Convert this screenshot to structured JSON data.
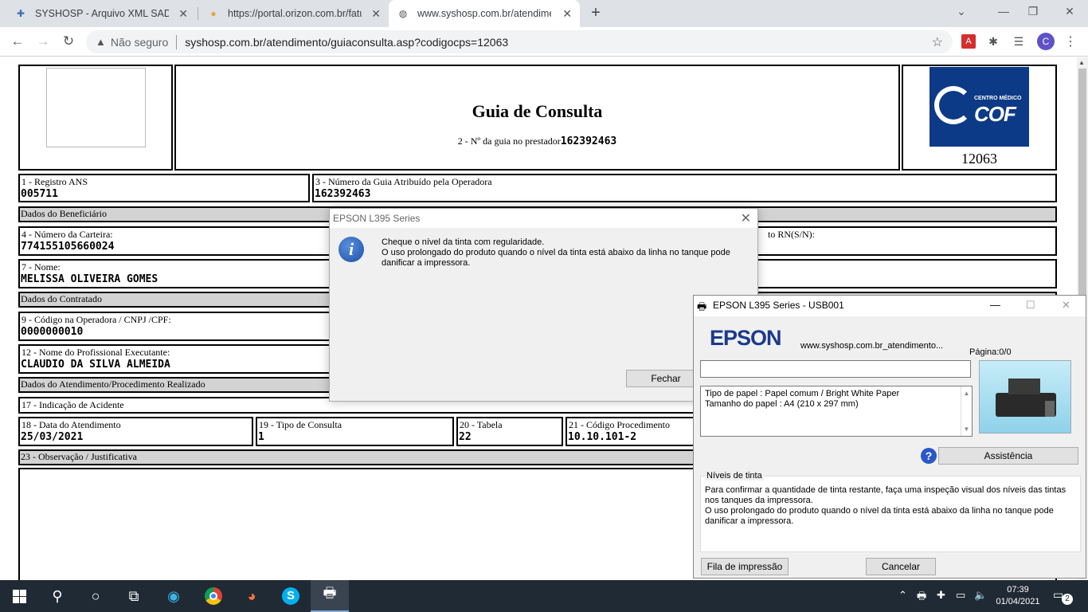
{
  "browser": {
    "tabs": [
      {
        "title": "SYSHOSP - Arquivo XML SADT",
        "icon": "syshosp-favicon"
      },
      {
        "title": "https://portal.orizon.com.br/fatur",
        "icon": "orizon-favicon"
      },
      {
        "title": "www.syshosp.com.br/atendiment",
        "icon": "globe-favicon"
      }
    ],
    "security_label": "Não seguro",
    "url": "syshosp.com.br/atendimento/guiaconsulta.asp?codigocps=12063",
    "profile_initial": "C"
  },
  "guia": {
    "title": "Guia de Consulta",
    "guia_prestador_label": "2 - Nº da guia no prestador",
    "guia_prestador_value": "162392463",
    "logo_line1": "CENTRO MÉDICO",
    "logo_line2": "COF",
    "codigo": "12063",
    "registro_ans_label": "1 - Registro ANS",
    "registro_ans_value": "005711",
    "numero_guia_operadora_label": "3 - Número da Guia Atribuído pela Operadora",
    "numero_guia_operadora_value": "162392463",
    "section_beneficiario": "Dados do Beneficiário",
    "carteira_label": "4 - Número da Carteira:",
    "carteira_value": "774155105660024",
    "rn_label": "to RN(S/N):",
    "nome_label": "7 - Nome:",
    "nome_value": "MELISSA OLIVEIRA GOMES",
    "section_contratado": "Dados do Contratado",
    "codigo_operadora_label": "9 - Código na Operadora / CNPJ /CPF:",
    "codigo_operadora_value": "0000000010",
    "profissional_label": "12 - Nome do Profissional Executante:",
    "profissional_value": "CLAUDIO DA SILVA ALMEIDA",
    "section_atendimento": "Dados do Atendimento/Procedimento Realizado",
    "acidente_label": "17 - Indicação de Acidente",
    "data_atendimento_label": "18 - Data do Atendimento",
    "data_atendimento_value": "25/03/2021",
    "tipo_consulta_label": "19 - Tipo de Consulta",
    "tipo_consulta_value": "1",
    "tabela_label": "20 - Tabela",
    "tabela_value": "22",
    "codigo_procedimento_label": "21 - Código Procedimento",
    "codigo_procedimento_value": "10.10.101-2",
    "observacao_label": "23 - Observação / Justificativa"
  },
  "epson_message": {
    "title": "EPSON L395 Series",
    "line1": "Cheque o nível da tinta com regularidade.",
    "line2": "O uso prolongado do produto quando o nível da tinta está abaixo da linha no tanque pode",
    "line3": "danificar a impressora.",
    "button": "Fechar"
  },
  "epson_window": {
    "title": "EPSON L395 Series - USB001",
    "logo": "EPSON",
    "document": "www.syshosp.com.br_atendimento...",
    "page_label": "Página:0/0",
    "paper_type": "Tipo de papel : Papel comum / Bright White Paper",
    "paper_size": "Tamanho do papel : A4 (210 x 297 mm)",
    "assist_button": "Assistência",
    "ink_group_label": "Níveis de tinta",
    "ink_line1": "Para confirmar a quantidade de tinta restante, faça uma inspeção visual dos níveis das tintas",
    "ink_line2": "nos tanques da impressora.",
    "ink_line3": "O uso prolongado do produto quando o nível da tinta está abaixo da linha no tanque pode",
    "ink_line4": "danificar a impressora.",
    "queue_button": "Fila de impressão",
    "cancel_button": "Cancelar"
  },
  "taskbar": {
    "time": "07:39",
    "date": "01/04/2021",
    "notification_count": "2"
  }
}
